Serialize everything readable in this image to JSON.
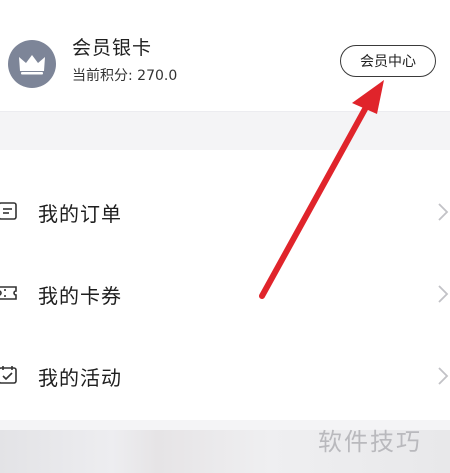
{
  "member": {
    "level": "会员银卡",
    "points_text": "当前积分: 270.0",
    "center_button": "会员中心",
    "avatar_icon": "crown-icon"
  },
  "menu": {
    "items": [
      {
        "label": "我的订单",
        "icon": "order-list-icon"
      },
      {
        "label": "我的卡券",
        "icon": "coupon-ticket-icon"
      },
      {
        "label": "我的活动",
        "icon": "calendar-check-icon"
      }
    ]
  },
  "watermark": "软件技巧",
  "colors": {
    "arrow": "#e0242b",
    "avatar_bg": "#7d8598",
    "page_bg": "#f4f4f6"
  }
}
